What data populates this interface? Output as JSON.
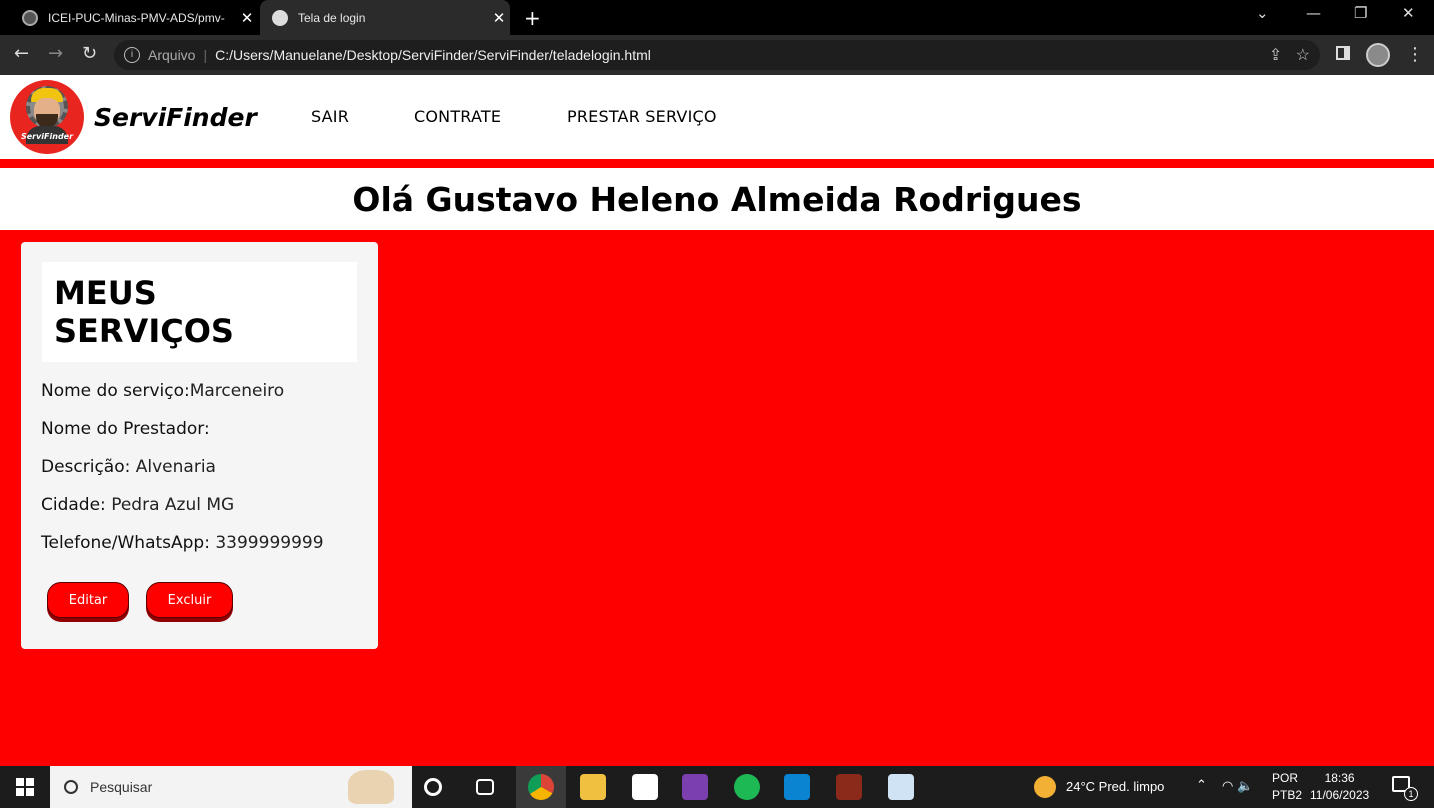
{
  "browser": {
    "tabs": [
      {
        "title": "ICEI-PUC-Minas-PMV-ADS/pmv-",
        "active": false
      },
      {
        "title": "Tela de login",
        "active": true
      }
    ],
    "address": {
      "security_label": "Arquivo",
      "url": "C:/Users/Manuelane/Desktop/ServiFinder/ServiFinder/teladelogin.html"
    }
  },
  "header": {
    "logo_text": "ServiFinder",
    "brand": "ServiFinder",
    "menu": [
      "SAIR",
      "CONTRATE",
      "PRESTAR SERVIÇO"
    ]
  },
  "greeting": "Olá Gustavo Heleno Almeida Rodrigues",
  "service_card": {
    "title": "MEUS SERVIÇOS",
    "fields": [
      {
        "label": "Nome do serviço:",
        "value": "Marceneiro"
      },
      {
        "label": "Nome do Prestador:",
        "value": ""
      },
      {
        "label": "Descrição:",
        "value": "Alvenaria"
      },
      {
        "label": "Cidade:",
        "value": "Pedra Azul MG"
      },
      {
        "label": "Telefone/WhatsApp:",
        "value": "3399999999"
      }
    ],
    "buttons": {
      "edit": "Editar",
      "delete": "Excluir"
    }
  },
  "taskbar": {
    "search_placeholder": "Pesquisar",
    "weather": "24°C  Pred. limpo",
    "language": "POR",
    "layout": "PTB2",
    "time": "18:36",
    "date": "11/06/2023",
    "notification_count": "1"
  },
  "colors": {
    "page_background": "#ff0000",
    "button": "#ff0000",
    "card": "#f5f5f5"
  }
}
